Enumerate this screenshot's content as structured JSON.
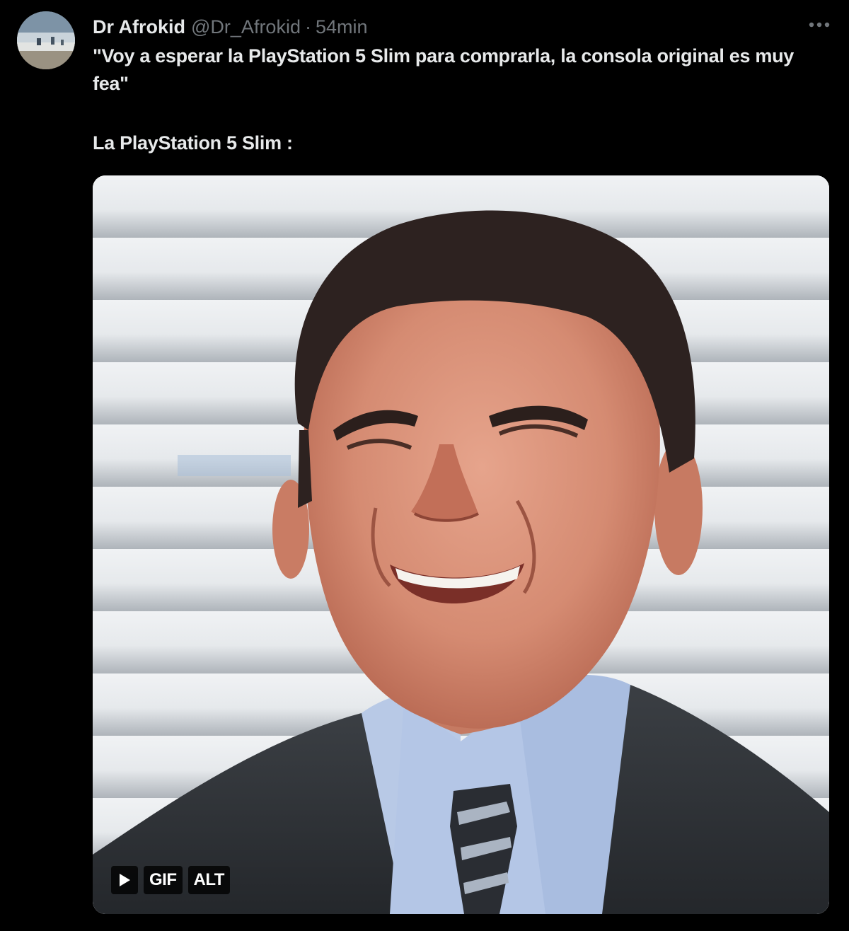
{
  "tweet": {
    "author": {
      "display_name": "Dr Afrokid",
      "handle": "@Dr_Afrokid",
      "separator": "·",
      "time": "54min"
    },
    "more_icon": "more-horizontal-icon",
    "text_line_1": "\"Voy a esperar la PlayStation 5 Slim para comprarla, la consola original es muy fea\"",
    "text_line_2": "La PlayStation 5 Slim :",
    "media": {
      "type": "gif",
      "play_icon": "play-icon",
      "gif_label": "GIF",
      "alt_label": "ALT"
    }
  },
  "colors": {
    "background": "#000000",
    "primary_text": "#e7e9ea",
    "secondary_text": "#71767b"
  }
}
